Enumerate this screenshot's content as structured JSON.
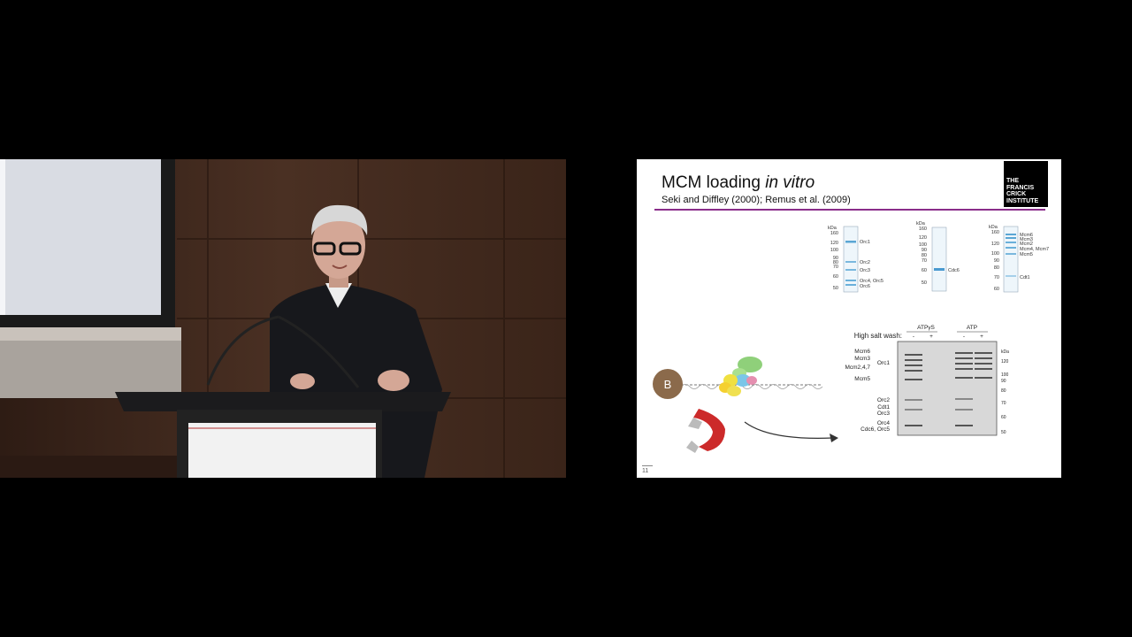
{
  "slide": {
    "title_main": "MCM loading ",
    "title_italic": "in vitro",
    "subtitle": "Seki and Diffley (2000); Remus et al. (2009)",
    "logo_lines": [
      "THE",
      "FRANCIS",
      "CRICK",
      "INSTITUTE"
    ],
    "page_number": "11",
    "gel1": {
      "unit": "kDa",
      "markers": [
        "160",
        "120",
        "100",
        "90",
        "80",
        "70",
        "60",
        "50"
      ],
      "bands": [
        "Orc1",
        "Orc2",
        "Orc3",
        "Orc4, Orc5",
        "Orc6"
      ]
    },
    "gel2": {
      "unit": "kDa",
      "markers": [
        "160",
        "120",
        "100",
        "90",
        "80",
        "70",
        "60",
        "50"
      ],
      "bands": [
        "Cdc6"
      ]
    },
    "gel3": {
      "unit": "kDa",
      "markers": [
        "160",
        "120",
        "100",
        "90",
        "80",
        "70",
        "60"
      ],
      "bands": [
        "Mcm6",
        "Mcm3",
        "Mcm2",
        "Mcm4, Mcm7",
        "Mcm5",
        "Cdt1"
      ]
    },
    "assay": {
      "condition_left": "ATPγS",
      "condition_right": "ATP",
      "wash_label": "High salt wash:",
      "minus": "-",
      "plus": "+",
      "bead_label": "B",
      "unit": "kDa",
      "markers": [
        "120",
        "100",
        "90",
        "80",
        "70",
        "60",
        "50"
      ],
      "band_labels": [
        "Mcm6",
        "Mcm3",
        "Orc1",
        "Mcm2,4,7",
        "Mcm5",
        "Orc2",
        "Cdt1",
        "Orc3",
        "Orc4",
        "Cdc6, Orc5"
      ]
    }
  }
}
